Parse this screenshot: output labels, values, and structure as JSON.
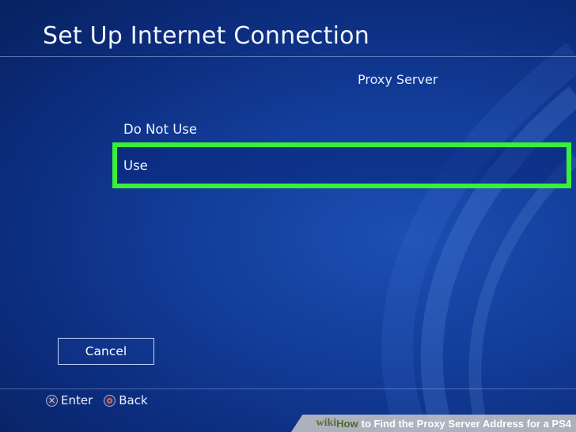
{
  "screen": {
    "title": "Set Up Internet Connection",
    "section_label": "Proxy Server"
  },
  "options": [
    {
      "label": "Do Not Use",
      "selected": false
    },
    {
      "label": "Use",
      "selected": true
    }
  ],
  "cancel_button": {
    "label": "Cancel"
  },
  "footer": {
    "enter_label": "Enter",
    "back_label": "Back",
    "enter_icon": "cross-button-icon",
    "back_icon": "circle-button-icon"
  },
  "watermark": {
    "wiki": "wiki",
    "how": "How",
    "rest": "to Find the Proxy Server Address for a PS4"
  },
  "colors": {
    "background": "#123c98",
    "highlight_border": "#38f03a",
    "text": "#f0f4ff"
  }
}
